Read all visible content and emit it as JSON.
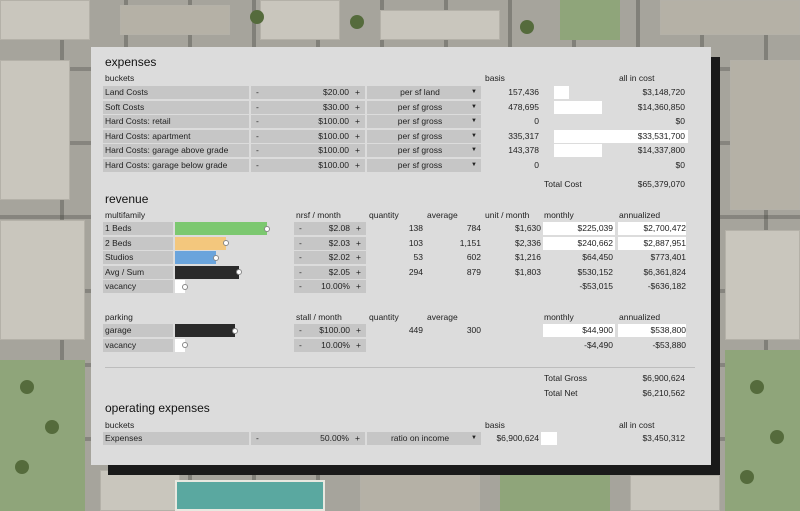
{
  "colors": {
    "beds1": "#7cc870",
    "beds2": "#f3c77d",
    "studios": "#6aa4dc",
    "dark": "#2a2a2a"
  },
  "expenses": {
    "title": "expenses",
    "header": {
      "buckets": "buckets",
      "basis": "basis",
      "all_in": "all in cost"
    },
    "rows": [
      {
        "label": "Land Costs",
        "value": "$20.00",
        "unit": "per sf land",
        "basis": "157,436",
        "cost": "$3,148,720"
      },
      {
        "label": "Soft Costs",
        "value": "$30.00",
        "unit": "per sf gross",
        "basis": "478,695",
        "cost": "$14,360,850"
      },
      {
        "label": "Hard Costs: retail",
        "value": "$100.00",
        "unit": "per sf gross",
        "basis": "0",
        "cost": "$0"
      },
      {
        "label": "Hard Costs: apartment",
        "value": "$100.00",
        "unit": "per sf gross",
        "basis": "335,317",
        "cost": "$33,531,700"
      },
      {
        "label": "Hard Costs: garage above grade",
        "value": "$100.00",
        "unit": "per sf gross",
        "basis": "143,378",
        "cost": "$14,337,800"
      },
      {
        "label": "Hard Costs: garage below grade",
        "value": "$100.00",
        "unit": "per sf gross",
        "basis": "0",
        "cost": "$0"
      }
    ],
    "total_label": "Total Cost",
    "total_value": "$65,379,070"
  },
  "revenue": {
    "title": "revenue",
    "multifamily": {
      "header": {
        "name": "multifamily",
        "nrsf": "nrsf / month",
        "quantity": "quantity",
        "average": "average",
        "unit_month": "unit / month",
        "monthly": "monthly",
        "annualized": "annualized"
      },
      "rows": [
        {
          "label": "1 Beds",
          "value": "$2.08",
          "quantity": "138",
          "average": "784",
          "unit_month": "$1,630",
          "monthly": "$225,039",
          "annualized": "$2,700,472",
          "share": 1.0
        },
        {
          "label": "2 Beds",
          "value": "$2.03",
          "quantity": "103",
          "average": "1,151",
          "unit_month": "$2,336",
          "monthly": "$240,662",
          "annualized": "$2,887,951",
          "share": 0.55
        },
        {
          "label": "Studios",
          "value": "$2.02",
          "quantity": "53",
          "average": "602",
          "unit_month": "$1,216",
          "monthly": "$64,450",
          "annualized": "$773,401",
          "share": 0.45
        },
        {
          "label": "Avg / Sum",
          "value": "$2.05",
          "quantity": "294",
          "average": "879",
          "unit_month": "$1,803",
          "monthly": "$530,152",
          "annualized": "$6,361,824",
          "share": 0.7
        },
        {
          "label": "vacancy",
          "value": "10.00%",
          "quantity": "",
          "average": "",
          "unit_month": "",
          "monthly": "-$53,015",
          "annualized": "-$636,182",
          "share": 0.1
        }
      ]
    },
    "parking": {
      "header": {
        "name": "parking",
        "stall": "stall / month",
        "quantity": "quantity",
        "average": "average",
        "monthly": "monthly",
        "annualized": "annualized"
      },
      "rows": [
        {
          "label": "garage",
          "value": "$100.00",
          "quantity": "449",
          "average": "300",
          "monthly": "$44,900",
          "annualized": "$538,800",
          "share": 0.65
        },
        {
          "label": "vacancy",
          "value": "10.00%",
          "quantity": "",
          "average": "",
          "monthly": "-$4,490",
          "annualized": "-$53,880",
          "share": 0.1
        }
      ]
    },
    "total_gross_label": "Total Gross",
    "total_gross_value": "$6,900,624",
    "total_net_label": "Total Net",
    "total_net_value": "$6,210,562"
  },
  "opex": {
    "title": "operating expenses",
    "header": {
      "buckets": "buckets",
      "basis": "basis",
      "all_in": "all in cost"
    },
    "row": {
      "label": "Expenses",
      "value": "50.00%",
      "unit": "ratio on income",
      "basis": "$6,900,624",
      "cost": "$3,450,312"
    }
  },
  "controls": {
    "minus": "-",
    "plus": "+",
    "caret": "▼"
  }
}
